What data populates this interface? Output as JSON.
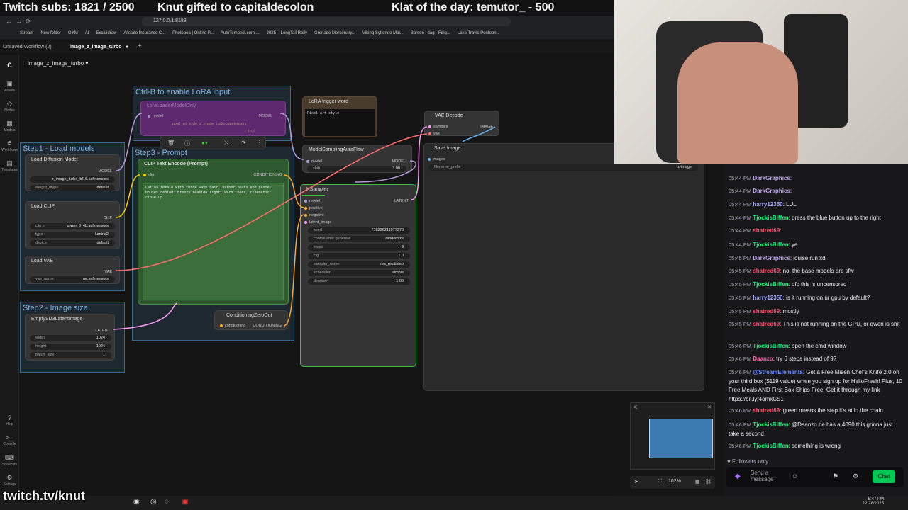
{
  "overlay": {
    "subs": "Twitch subs: 1821 / 2500",
    "gift": "Knut gifted to capitaldecolon",
    "klat": "Klat of the day: temutor_ - 500",
    "channel": "twitch.tv/knut"
  },
  "browser": {
    "url": "127.0.0.1:8188",
    "bookmarks": [
      "Stream",
      "New folder",
      "GYM",
      "AI",
      "Excalidraw",
      "Allstate Insurance C...",
      "Photopea | Online P...",
      "AutoTempest.com:...",
      "2025 – LongTail Rally",
      "Grenade Mercenary...",
      "Viking Syttende Mai...",
      "Barsen i dag - Følg...",
      "Lake Travis Pontoon..."
    ]
  },
  "workflow_tabs": {
    "unsaved": "Unsaved Workflow (2)",
    "active": "image_z_image_turbo"
  },
  "workflow_title": "image_z_image_turbo",
  "left_rail": [
    "Assets",
    "Nodes",
    "Models",
    "Workflows",
    "Templates",
    "Help",
    "Console",
    "Shortcuts",
    "Settings"
  ],
  "groups": {
    "lora": "Ctrl-B to enable LoRA input",
    "step1": "Step1 - Load models",
    "step2": "Step2 - Image size",
    "step3": "Step3 - Prompt"
  },
  "nodes": {
    "lora_loader": {
      "title": "LoraLoaderModelOnly",
      "model": "model",
      "output": "MODEL",
      "lora_name": "pixel_art_style_z_image_turbo.safetensors",
      "strength": "1.00"
    },
    "lora_trigger": {
      "title": "LoRA trigger word",
      "text": "Pixel art style"
    },
    "load_diffusion": {
      "title": "Load Diffusion Model",
      "output": "MODEL",
      "unet_name": "z_image_turbo_bf16.safetensors",
      "weight_dtype_label": "weight_dtype",
      "weight_dtype": "default"
    },
    "load_clip": {
      "title": "Load CLIP",
      "output": "CLIP",
      "clip_name_label": "clip_n",
      "clip_name": "qwen_3_4b.safetensors",
      "type_label": "type",
      "type": "lumina2",
      "device_label": "device",
      "device": "default"
    },
    "load_vae": {
      "title": "Load VAE",
      "output": "VAE",
      "vae_name_label": "vae_name",
      "vae_name": "ae.safetensors"
    },
    "empty_latent": {
      "title": "EmptySD3LatentImage",
      "output": "LATENT",
      "width_label": "width",
      "width": "1024",
      "height_label": "height",
      "height": "1024",
      "batch_label": "batch_size",
      "batch": "1"
    },
    "clip_encode": {
      "title": "CLIP Text Encode (Prompt)",
      "input": "clip",
      "output": "CONDITIONING",
      "text": "Latina female with thick wavy hair, harbor boats and pastel houses behind. Breezy seaside light, warm tones, cinematic close-up."
    },
    "model_sampling": {
      "title": "ModelSamplingAuraFlow",
      "input": "model",
      "output": "MODEL",
      "shift_label": "shift",
      "shift": "3.00"
    },
    "ksampler": {
      "title": "KSampler",
      "output": "LATENT",
      "inputs": [
        "model",
        "positive",
        "negative",
        "latent_image"
      ],
      "widgets": [
        {
          "label": "seed",
          "value": "716296211977978"
        },
        {
          "label": "control after generate",
          "value": "randomize"
        },
        {
          "label": "steps",
          "value": "9"
        },
        {
          "label": "cfg",
          "value": "1.0"
        },
        {
          "label": "sampler_name",
          "value": "res_multistep"
        },
        {
          "label": "scheduler",
          "value": "simple"
        },
        {
          "label": "denoise",
          "value": "1.00"
        }
      ]
    },
    "cond_zero": {
      "title": "ConditioningZeroOut",
      "input": "conditioning",
      "output": "CONDITIONING"
    },
    "vae_decode": {
      "title": "VAE Decode",
      "in1": "samples",
      "in2": "vae",
      "output": "IMAGE"
    },
    "save_image": {
      "title": "Save Image",
      "input": "images",
      "prefix_label": "filename_prefix",
      "prefix": "z-image"
    }
  },
  "canvas_footer": {
    "zoom": "102%"
  },
  "chat": {
    "messages": [
      {
        "time": "05:44 PM",
        "user": "DarkGraphics",
        "color": "#b9a3e3",
        "text": ""
      },
      {
        "time": "05:44 PM",
        "user": "DarkGraphics",
        "color": "#b9a3e3",
        "text": ""
      },
      {
        "time": "05:44 PM",
        "user": "harry12350",
        "color": "#9ea7ff",
        "text": "LUL"
      },
      {
        "time": "05:44 PM",
        "user": "TjockisBiffen",
        "color": "#00ff7f",
        "text": "press the blue button up to the right"
      },
      {
        "time": "05:44 PM",
        "user": "shatred69",
        "color": "#ff4f70",
        "text": ""
      },
      {
        "time": "05:44 PM",
        "user": "TjockisBiffen",
        "color": "#00ff7f",
        "text": "ye"
      },
      {
        "time": "05:45 PM",
        "user": "DarkGraphics",
        "color": "#b9a3e3",
        "text": "louise run xd"
      },
      {
        "time": "05:45 PM",
        "user": "shatred69",
        "color": "#ff4f70",
        "text": "no, the base models are sfw"
      },
      {
        "time": "05:45 PM",
        "user": "TjockisBiffen",
        "color": "#00ff7f",
        "text": "ofc this is uncensored"
      },
      {
        "time": "05:45 PM",
        "user": "harry12350",
        "color": "#9ea7ff",
        "text": "is it running on ur gpu by default?"
      },
      {
        "time": "05:45 PM",
        "user": "shatred69",
        "color": "#ff4f70",
        "text": "mostly"
      },
      {
        "time": "05:45 PM",
        "user": "shatred69",
        "color": "#ff4f70",
        "text": "This is not running on the GPU, or qwen is shit"
      },
      {
        "time": "05:46 PM",
        "user": "TjockisBiffen",
        "color": "#00ff7f",
        "text": "open the cmd window"
      },
      {
        "time": "05:46 PM",
        "user": "Daanzo",
        "color": "#ff69b4",
        "text": "try 6 steps instead of 9?"
      },
      {
        "time": "05:46 PM",
        "user": "@StreamElements",
        "color": "#6b8cff",
        "text": "Get a Free Misen Chef's Knife 2.0 on your third box ($119 value) when you sign up for HelloFresh! Plus, 10 Free Meals AND First Box Ships Free! Get it through my link https://bit.ly/4omkCS1"
      },
      {
        "time": "05:46 PM",
        "user": "shatred69",
        "color": "#ff4f70",
        "text": "green means the step it's at in the chain"
      },
      {
        "time": "05:46 PM",
        "user": "TjockisBiffen",
        "color": "#00ff7f",
        "text": "@Daanzo  he has a 4090 this gonna just take a second"
      },
      {
        "time": "05:46 PM",
        "user": "TjockisBiffen",
        "color": "#00ff7f",
        "text": "something is wrong"
      }
    ],
    "followers_only": "Followers only",
    "placeholder": "Send a message",
    "chat_button": "Chat"
  },
  "taskbar": {
    "time": "5:47 PM",
    "date": "12/28/2025"
  }
}
